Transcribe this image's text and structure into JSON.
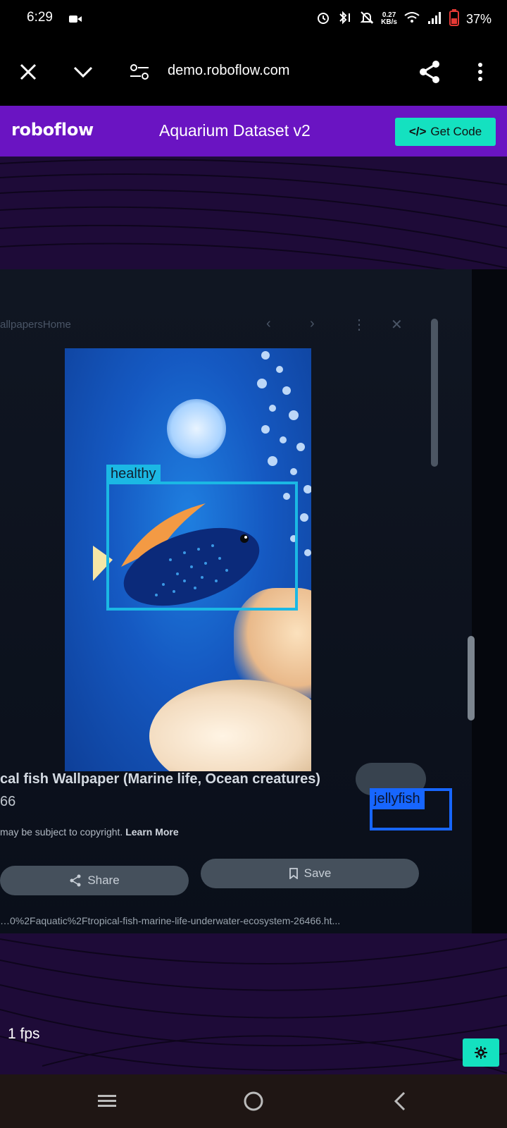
{
  "status_bar": {
    "time": "6:29",
    "net_speed_value": "0.27",
    "net_speed_unit": "KB/s",
    "battery": "37%",
    "icons": [
      "camera-icon",
      "alarm-icon",
      "bluetooth-icon",
      "mute-icon",
      "wifi-icon",
      "signal-icon",
      "battery-icon"
    ]
  },
  "browser": {
    "url": "demo.roboflow.com",
    "icons": [
      "close-icon",
      "chevron-down-icon",
      "site-settings-icon",
      "share-icon",
      "more-icon"
    ]
  },
  "header": {
    "logo": "roboflow",
    "title": "Aquarium Dataset v2",
    "get_code_label": "Get Code",
    "get_code_icon": "</>"
  },
  "detections": [
    {
      "label": "healthy",
      "color": "#1bb8e4"
    },
    {
      "label": "jellyfish",
      "color": "#1766ff"
    }
  ],
  "camera_background": {
    "site_name": "allpapersHome",
    "caption": "cal fish Wallpaper (Marine life, Ocean creatures)",
    "caption_sub": "66",
    "copyright_text": "may be subject to copyright.",
    "learn_more": "Learn More",
    "share_label": "Share",
    "save_label": "Save",
    "url_text": "…0%2Faquatic%2Ftropical-fish-marine-life-underwater-ecosystem-26466.ht..."
  },
  "footer": {
    "fps": "1 fps",
    "settings_icon": "gear-icon"
  },
  "nav_bar": {
    "icons": [
      "recents-icon",
      "home-icon",
      "back-icon"
    ]
  },
  "colors": {
    "header_bg": "#6a14c2",
    "accent": "#14e1c0",
    "stage_bg": "#1e0b38"
  }
}
